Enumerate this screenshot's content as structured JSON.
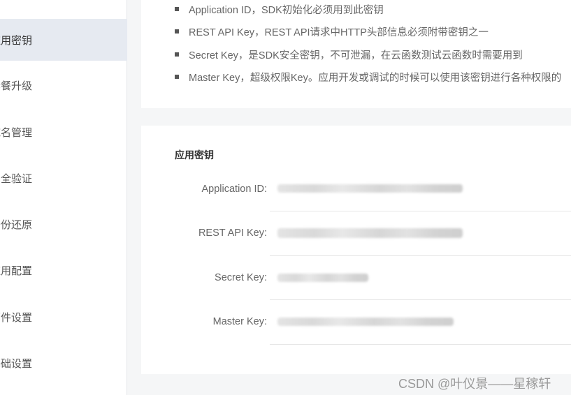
{
  "sidebar": {
    "items": [
      {
        "label": "应用密钥",
        "active": true
      },
      {
        "label": "套餐升级"
      },
      {
        "label": "域名管理"
      },
      {
        "label": "安全验证"
      },
      {
        "label": "备份还原"
      },
      {
        "label": "应用配置"
      },
      {
        "label": "邮件设置"
      },
      {
        "label": "基础设置"
      }
    ]
  },
  "description": {
    "bullets": [
      "Application ID，SDK初始化必须用到此密钥",
      "REST API Key，REST API请求中HTTP头部信息必须附带密钥之一",
      "Secret Key，是SDK安全密钥，不可泄漏，在云函数测试云函数时需要用到",
      "Master Key，超级权限Key。应用开发或调试的时候可以使用该密钥进行各种权限的"
    ]
  },
  "keys_section": {
    "title": "应用密钥",
    "rows": [
      {
        "label": "Application ID:",
        "value_blurred": true
      },
      {
        "label": "REST API Key:",
        "value_blurred": true
      },
      {
        "label": "Secret Key:",
        "value_blurred": true
      },
      {
        "label": "Master Key:",
        "value_blurred": true
      }
    ]
  },
  "watermark": "CSDN @叶仪景——星稼轩"
}
